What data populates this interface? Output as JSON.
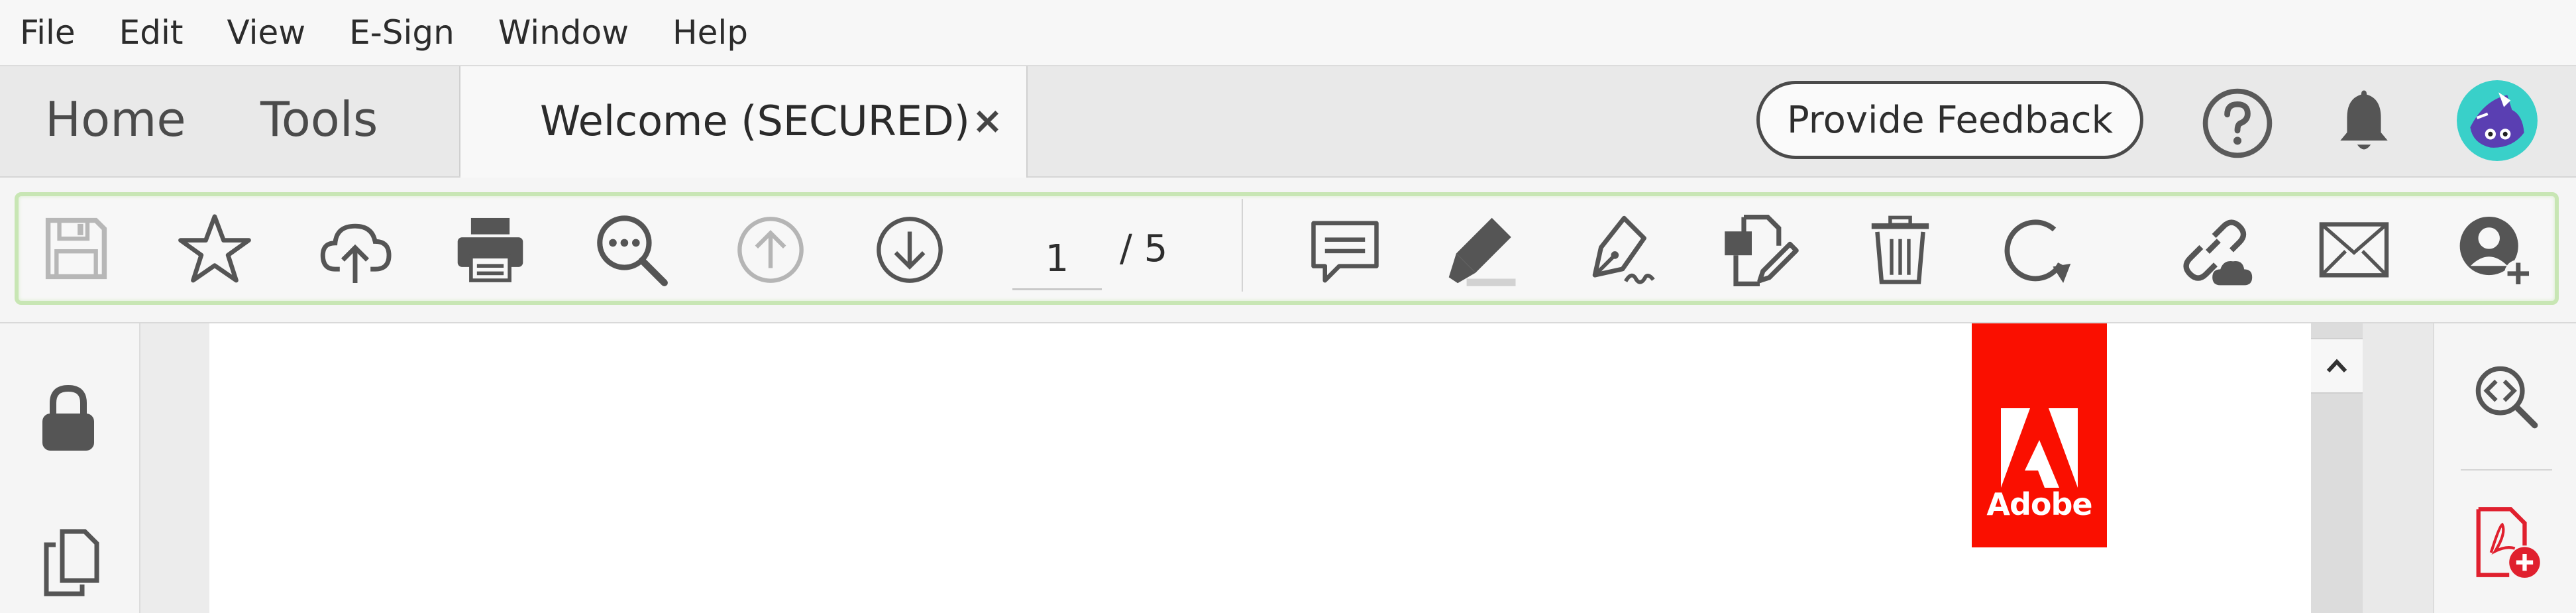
{
  "menu": [
    "File",
    "Edit",
    "View",
    "E-Sign",
    "Window",
    "Help"
  ],
  "tabs": {
    "home": "Home",
    "tools": "Tools",
    "document": {
      "title": "Welcome (SECURED)",
      "close": "×"
    }
  },
  "header": {
    "feedback_label": "Provide Feedback",
    "icons": [
      "help-icon",
      "notification-bell-icon",
      "user-avatar"
    ]
  },
  "toolbar": {
    "page_current": "1",
    "page_total": "/  5",
    "icons": [
      "save-icon",
      "bookmark-star-icon",
      "upload-cloud-icon",
      "print-icon",
      "find-text-icon",
      "previous-page-icon",
      "next-page-icon",
      "comment-icon",
      "highlight-icon",
      "sign-icon",
      "edit-pdf-icon",
      "delete-icon",
      "rotate-icon",
      "share-link-icon",
      "email-icon",
      "add-user-icon"
    ]
  },
  "document": {
    "logo_text": "Adobe"
  },
  "colors": {
    "accent_green": "#c8e6b4",
    "adobe_red": "#fa0f00",
    "icon_gray": "#555555",
    "disabled_gray": "#b5b5b5"
  }
}
